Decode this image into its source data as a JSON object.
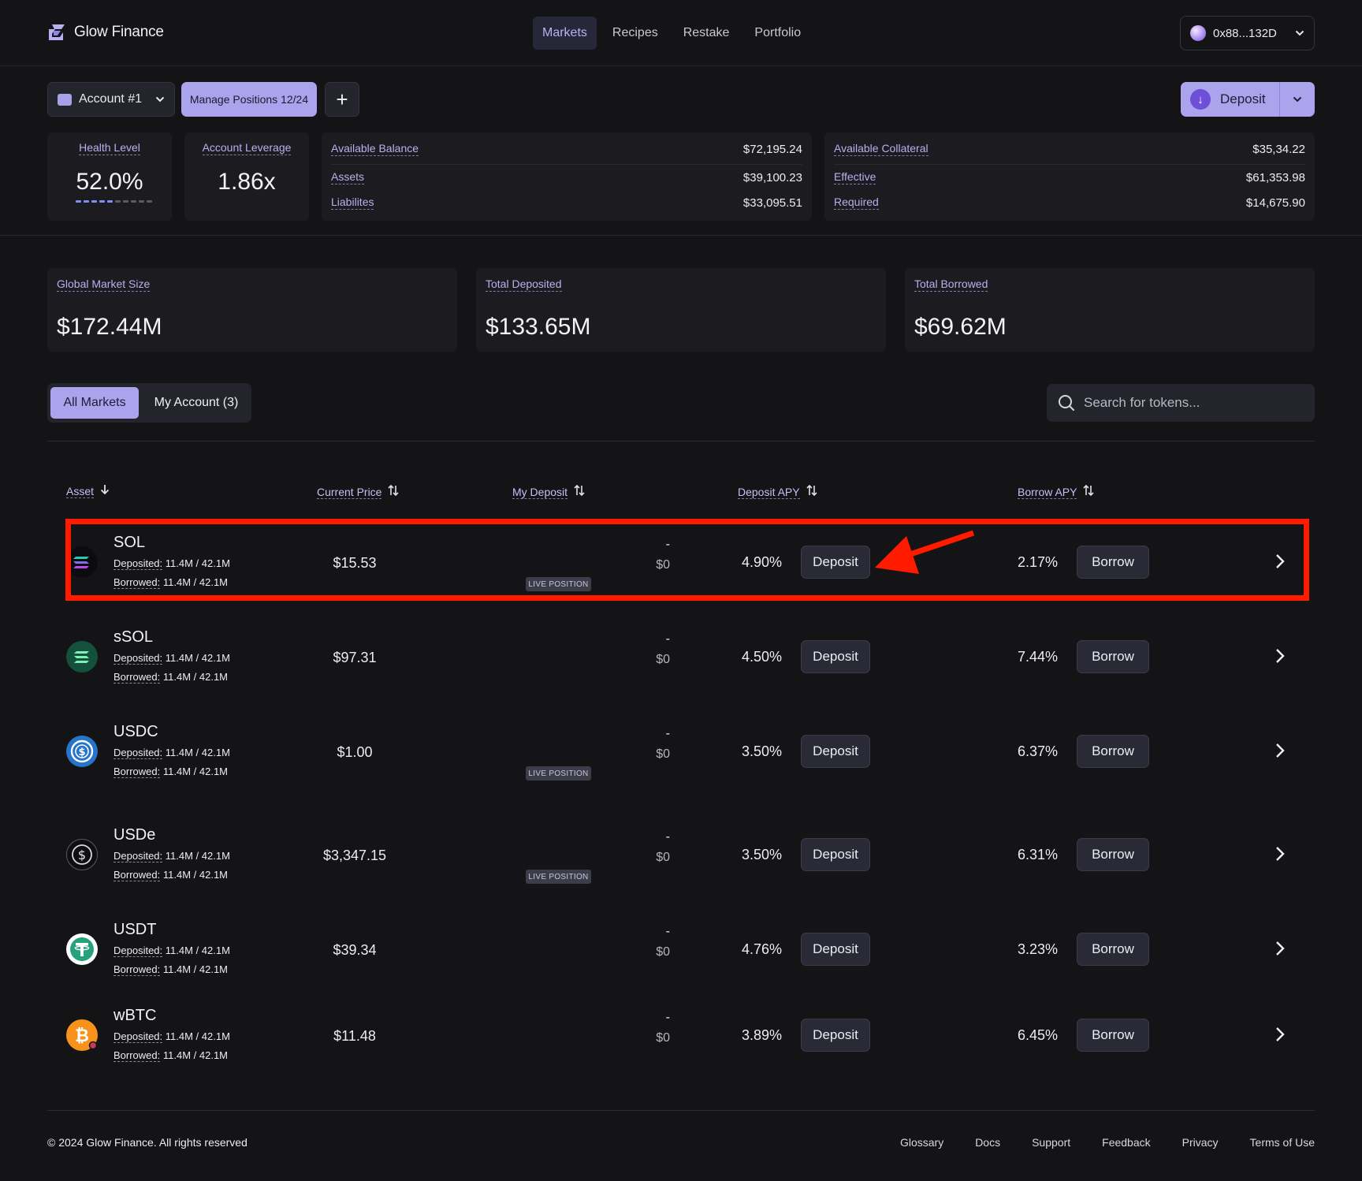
{
  "brand": {
    "name": "Glow Finance"
  },
  "nav": [
    "Markets",
    "Recipes",
    "Restake",
    "Portfolio"
  ],
  "nav_active": "Markets",
  "wallet": {
    "address": "0x88...132D",
    "icon": "wallet-avatar-icon"
  },
  "account_bar": {
    "account_label": "Account #1",
    "manage_label": "Manage Positions 12/24",
    "plus_label": "+",
    "deposit_label": "Deposit"
  },
  "health": {
    "label": "Health Level",
    "value": "52.0%",
    "bar_level": 0.5
  },
  "leverage": {
    "label": "Account Leverage",
    "value": "1.86x"
  },
  "balance": {
    "rows": [
      {
        "label": "Available Balance",
        "value": "$72,195.24"
      },
      {
        "label": "Assets",
        "value": "$39,100.23"
      },
      {
        "label": "Liabilites",
        "value": "$33,095.51"
      }
    ]
  },
  "collateral": {
    "rows": [
      {
        "label": "Available Collateral",
        "value": "$35,34.22"
      },
      {
        "label": "Effective",
        "value": "$61,353.98"
      },
      {
        "label": "Required",
        "value": "$14,675.90"
      }
    ]
  },
  "market_stats": [
    {
      "label": "Global Market Size",
      "value": "$172.44M"
    },
    {
      "label": "Total Deposited",
      "value": "$133.65M"
    },
    {
      "label": "Total Borrowed",
      "value": "$69.62M"
    }
  ],
  "tabs": {
    "all": "All Markets",
    "mine": "My Account (3)"
  },
  "search": {
    "placeholder": "Search for tokens..."
  },
  "table": {
    "headers": {
      "asset": "Asset",
      "price": "Current Price",
      "my_deposit": "My Deposit",
      "deposit_apy": "Deposit APY",
      "borrow_apy": "Borrow APY"
    },
    "deposited_label": "Deposited:",
    "borrowed_label": "Borrowed:",
    "live_label": "LIVE POSITION",
    "deposit_btn": "Deposit",
    "borrow_btn": "Borrow",
    "rows": [
      {
        "name": "SOL",
        "icon": "sol-icon",
        "deposited": "11.4M / 42.1M",
        "borrowed": "11.4M / 42.1M",
        "price": "$15.53",
        "dash": "-",
        "my_deposit": "$0",
        "live": true,
        "deposit_apy": "4.90%",
        "borrow_apy": "2.17%"
      },
      {
        "name": "sSOL",
        "icon": "ssol-icon",
        "deposited": "11.4M / 42.1M",
        "borrowed": "11.4M / 42.1M",
        "price": "$97.31",
        "dash": "-",
        "my_deposit": "$0",
        "live": false,
        "deposit_apy": "4.50%",
        "borrow_apy": "7.44%"
      },
      {
        "name": "USDC",
        "icon": "usdc-icon",
        "deposited": "11.4M / 42.1M",
        "borrowed": "11.4M / 42.1M",
        "price": "$1.00",
        "dash": "-",
        "my_deposit": "$0",
        "live": true,
        "deposit_apy": "3.50%",
        "borrow_apy": "6.37%"
      },
      {
        "name": "USDe",
        "icon": "usde-icon",
        "deposited": "11.4M / 42.1M",
        "borrowed": "11.4M / 42.1M",
        "price": "$3,347.15",
        "dash": "-",
        "my_deposit": "$0",
        "live": true,
        "deposit_apy": "3.50%",
        "borrow_apy": "6.31%"
      },
      {
        "name": "USDT",
        "icon": "usdt-icon",
        "deposited": "11.4M / 42.1M",
        "borrowed": "11.4M / 42.1M",
        "price": "$39.34",
        "dash": "-",
        "my_deposit": "$0",
        "live": false,
        "deposit_apy": "4.76%",
        "borrow_apy": "3.23%"
      },
      {
        "name": "wBTC",
        "icon": "wbtc-icon",
        "deposited": "11.4M / 42.1M",
        "borrowed": "11.4M / 42.1M",
        "price": "$11.48",
        "dash": "-",
        "my_deposit": "$0",
        "live": false,
        "deposit_apy": "3.89%",
        "borrow_apy": "6.45%"
      }
    ]
  },
  "annotation": {
    "highlight_color": "#ff1a00",
    "highlighted_row": "SOL"
  },
  "footer": {
    "copyright": "© 2024 Glow Finance. All rights reserved",
    "links": [
      "Glossary",
      "Docs",
      "Support",
      "Feedback",
      "Privacy",
      "Terms of Use"
    ]
  },
  "colors": {
    "accent": "#aba4ec",
    "background": "#141416",
    "card": "#1c1c20"
  }
}
